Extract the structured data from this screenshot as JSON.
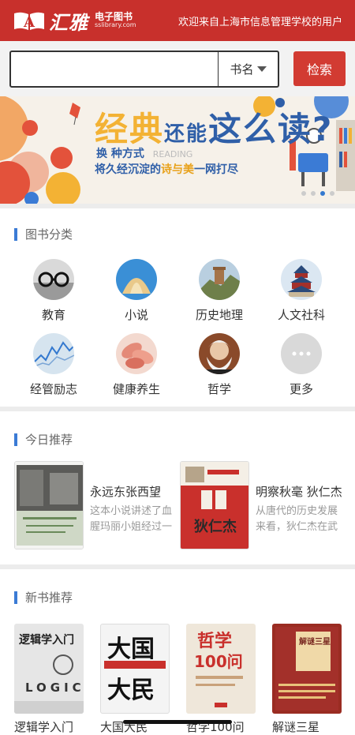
{
  "header": {
    "brand": "汇雅",
    "subtitle_top": "电子图书",
    "subtitle_bottom": "sslibrary.com",
    "welcome": "欢迎来自上海市信息管理学校的用户",
    "bg_color": "#c8302c"
  },
  "search": {
    "value": "",
    "placeholder": "",
    "type_label": "书名",
    "button_label": "检索"
  },
  "banner": {
    "line1_a": "经典",
    "line1_b": "还能",
    "line1_c": "这么读?",
    "reading": "READING",
    "line2": "换 种方式",
    "line3_a": "将久经沉淀的",
    "line3_b": "诗与美",
    "line3_c": "一网打尽",
    "pages": 4,
    "active_page": 3
  },
  "categories": {
    "title": "图书分类",
    "items": [
      {
        "label": "教育",
        "icon": "glasses-icon"
      },
      {
        "label": "小说",
        "icon": "book-pages-icon"
      },
      {
        "label": "历史地理",
        "icon": "great-wall-icon"
      },
      {
        "label": "人文社科",
        "icon": "temple-icon"
      },
      {
        "label": "经管励志",
        "icon": "stock-chart-icon"
      },
      {
        "label": "健康养生",
        "icon": "flower-icon"
      },
      {
        "label": "哲学",
        "icon": "philosopher-portrait-icon"
      },
      {
        "label": "更多",
        "icon": "more-dots-icon"
      }
    ]
  },
  "today": {
    "title": "今日推荐",
    "items": [
      {
        "title": "永远东张西望",
        "desc": "这本小说讲述了血腥玛丽小姐经过一段时间的"
      },
      {
        "title": "明察秋毫 狄仁杰",
        "desc": "从唐代的历史发展来看，狄仁杰在武则天"
      }
    ]
  },
  "new_books": {
    "title": "新书推荐",
    "items": [
      {
        "title": "逻辑学入门",
        "cover_top": "逻辑学入门",
        "cover_mid": "LOGIC"
      },
      {
        "title": "大国大民",
        "cover_top": "大国",
        "cover_mid": "大民"
      },
      {
        "title": "哲学100问",
        "cover_top": "哲学",
        "cover_mid": "100问"
      },
      {
        "title": "解谜三星",
        "cover_top": "解谜三星",
        "cover_mid": ""
      }
    ]
  }
}
